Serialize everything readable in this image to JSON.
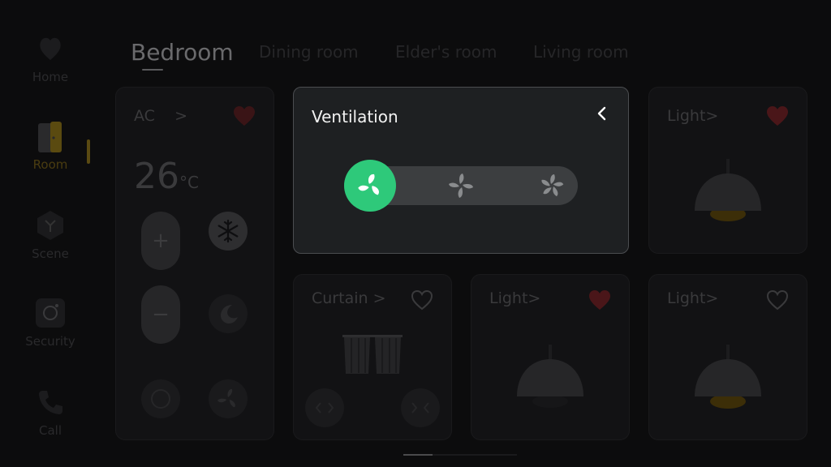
{
  "colors": {
    "accent_green": "#2ec97a",
    "active_yellow": "#e6b321",
    "heart_red": "#d8333a"
  },
  "sidebar": {
    "items": [
      {
        "label": "Home",
        "icon": "home-icon",
        "active": false
      },
      {
        "label": "Room",
        "icon": "room-icon",
        "active": true
      },
      {
        "label": "Scene",
        "icon": "scene-icon",
        "active": false
      },
      {
        "label": "Security",
        "icon": "security-icon",
        "active": false
      },
      {
        "label": "Call",
        "icon": "phone-icon",
        "active": false
      }
    ]
  },
  "tabs": [
    {
      "label": "Bedroom",
      "active": true
    },
    {
      "label": "Dining room",
      "active": false
    },
    {
      "label": "Elder's room",
      "active": false
    },
    {
      "label": "Living room",
      "active": false
    }
  ],
  "ac_card": {
    "title": "AC",
    "chevron": ">",
    "temperature": "26",
    "unit": "°C",
    "favorite": true,
    "plus": "+",
    "minus": "−"
  },
  "ventilation": {
    "title": "Ventilation",
    "fan_levels": 3,
    "selected_level": 1
  },
  "cards": {
    "light_top": {
      "title": "Light",
      "chevron": ">",
      "favorite": true,
      "on": true
    },
    "curtain": {
      "title": "Curtain",
      "chevron": ">",
      "favorite": false
    },
    "light_mid": {
      "title": "Light",
      "chevron": ">",
      "favorite": true,
      "on": false
    },
    "light_right": {
      "title": "Light",
      "chevron": ">",
      "favorite": false,
      "on": true
    }
  }
}
